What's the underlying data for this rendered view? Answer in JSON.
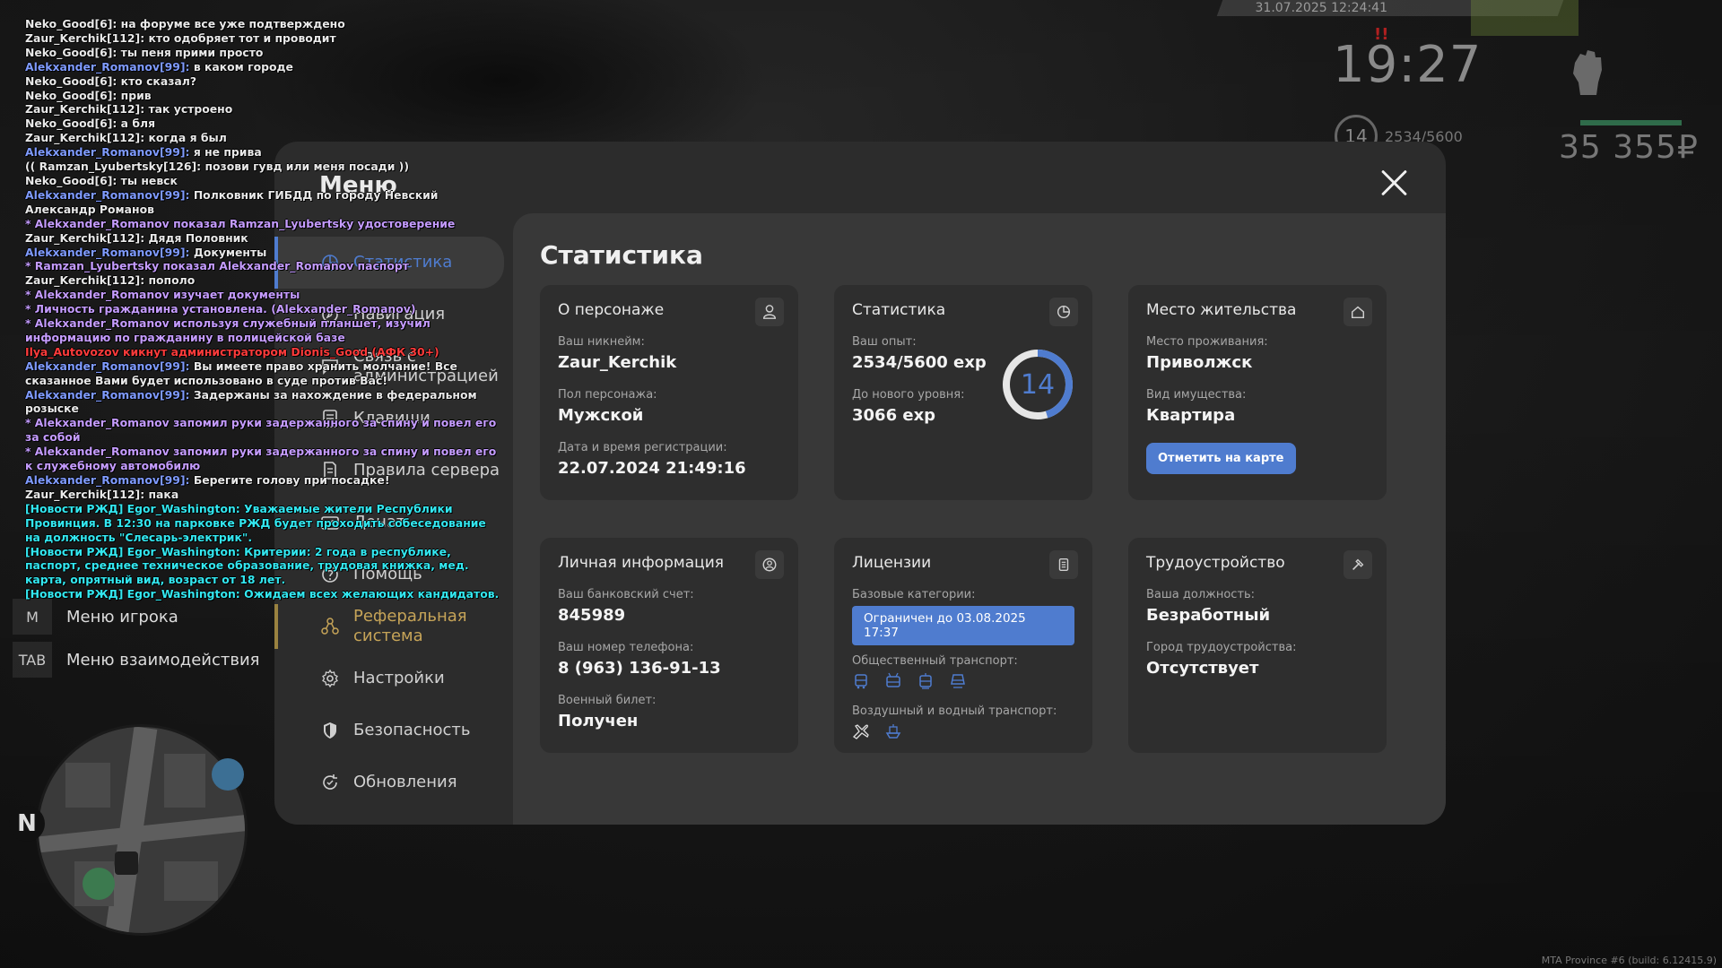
{
  "chat": [
    {
      "nick": "Neko_Good[6]:",
      "text": " на форуме все уже подтверждено",
      "nick_color": "white",
      "text_color": "white"
    },
    {
      "nick": "Zaur_Kerchik[112]:",
      "text": " кто одобряет тот и проводит",
      "nick_color": "white",
      "text_color": "white"
    },
    {
      "nick": "Neko_Good[6]:",
      "text": " ты пеня прими просто",
      "nick_color": "white",
      "text_color": "white"
    },
    {
      "nick": "Alekxander_Romanov[99]:",
      "text": " в каком городе",
      "nick_color": "blue",
      "text_color": "white"
    },
    {
      "nick": "Neko_Good[6]:",
      "text": " кто сказал?",
      "nick_color": "white",
      "text_color": "white"
    },
    {
      "nick": "Neko_Good[6]:",
      "text": " прив",
      "nick_color": "white",
      "text_color": "white"
    },
    {
      "nick": "Zaur_Kerchik[112]:",
      "text": " так устроено",
      "nick_color": "white",
      "text_color": "white"
    },
    {
      "nick": "Neko_Good[6]:",
      "text": " а бля",
      "nick_color": "white",
      "text_color": "white"
    },
    {
      "nick": "Zaur_Kerchik[112]:",
      "text": " когда я был",
      "nick_color": "white",
      "text_color": "white"
    },
    {
      "nick": "Alekxander_Romanov[99]:",
      "text": " я не прива",
      "nick_color": "blue",
      "text_color": "white"
    },
    {
      "nick": "((",
      "text": " Ramzan_Lyubertsky[126]: позови гувд или меня посади ))",
      "nick_color": "white",
      "text_color": "white"
    },
    {
      "nick": "Neko_Good[6]:",
      "text": " ты невск",
      "nick_color": "white",
      "text_color": "white"
    },
    {
      "nick": "Alekxander_Romanov[99]:",
      "text": " Полковник ГИБДД по городу Невский Александр Романов",
      "nick_color": "blue",
      "text_color": "white"
    },
    {
      "nick": "",
      "text": "* Alekxander_Romanov показал Ramzan_Lyubertsky удостоверение",
      "nick_color": "purple",
      "text_color": "purple"
    },
    {
      "nick": "Zaur_Kerchik[112]:",
      "text": " Дядя Половник",
      "nick_color": "white",
      "text_color": "white"
    },
    {
      "nick": "Alekxander_Romanov[99]:",
      "text": " Документы",
      "nick_color": "blue",
      "text_color": "white"
    },
    {
      "nick": "",
      "text": "* Ramzan_Lyubertsky показал Alekxander_Romanov паспорт",
      "nick_color": "purple",
      "text_color": "purple"
    },
    {
      "nick": "Zaur_Kerchik[112]:",
      "text": " пополо",
      "nick_color": "white",
      "text_color": "white"
    },
    {
      "nick": "",
      "text": "* Alekxander_Romanov изучает документы",
      "nick_color": "purple",
      "text_color": "purple"
    },
    {
      "nick": "",
      "text": "* Личность гражданина установлена. (Alekxander_Romanov)",
      "nick_color": "purple",
      "text_color": "purple"
    },
    {
      "nick": "",
      "text": "* Alekxander_Romanov используя служебный планшет, изучил информацию по гражданину в полицейской базе",
      "nick_color": "purple",
      "text_color": "purple"
    },
    {
      "nick": "",
      "text": "Ilya_Autovozov кикнут администратором Dionis_Good (АФК 30+)",
      "nick_color": "red",
      "text_color": "red"
    },
    {
      "nick": "Alekxander_Romanov[99]:",
      "text": " Вы имеете право хранить молчание! Все сказанное Вами будет использовано в суде против Вас!",
      "nick_color": "blue",
      "text_color": "white"
    },
    {
      "nick": "Alekxander_Romanov[99]:",
      "text": " Задержаны за нахождение в федеральном розыске",
      "nick_color": "blue",
      "text_color": "white"
    },
    {
      "nick": "",
      "text": "* Alekxander_Romanov запомил руки задержанного за спину и повел его за собой",
      "nick_color": "purple",
      "text_color": "purple"
    },
    {
      "nick": "",
      "text": "* Alekxander_Romanov запомил руки задержанного за спину и повел его к служебному автомобилю",
      "nick_color": "purple",
      "text_color": "purple"
    },
    {
      "nick": "Alekxander_Romanov[99]:",
      "text": " Берегите голову при посадке!",
      "nick_color": "blue",
      "text_color": "white"
    },
    {
      "nick": "Zaur_Kerchik[112]:",
      "text": " пака",
      "nick_color": "white",
      "text_color": "white"
    },
    {
      "nick": "",
      "text": "[Новости РЖД] Egor_Washington: Уважаемые жители Республики Провинция. В 12:30 на парковке РЖД будет проходить собеседование на должность \"Слесарь-электрик\".",
      "nick_color": "cyan",
      "text_color": "cyan"
    },
    {
      "nick": "",
      "text": "[Новости РЖД] Egor_Washington: Критерии: 2 года в республике, паспорт, среднее техническое образование, трудовая книжка, мед. карта, опрятный вид, возраст от 18 лет.",
      "nick_color": "cyan",
      "text_color": "cyan"
    },
    {
      "nick": "",
      "text": "[Новости РЖД] Egor_Washington: Ожидаем всех желающих кандидатов.",
      "nick_color": "cyan",
      "text_color": "cyan"
    }
  ],
  "hud": {
    "datetime": "31.07.2025 12:24:41",
    "clock": "19:27",
    "warning": "!!",
    "level": "14",
    "exp": "2534/5600",
    "money": "35 355₽",
    "health_fraction": 0.96
  },
  "quick_menu": [
    {
      "key": "M",
      "label": "Меню игрока"
    },
    {
      "key": "TAB",
      "label": "Меню взаимодействия"
    }
  ],
  "menu": {
    "title": "Меню",
    "nav": [
      {
        "label": "Статистика",
        "icon": "chart-pie-icon",
        "state": "active"
      },
      {
        "label": "Навигация",
        "icon": "compass-icon",
        "state": ""
      },
      {
        "label": "Связь с администрацией",
        "icon": "chat-icon",
        "state": ""
      },
      {
        "label": "Клавиши",
        "icon": "keyboard-icon",
        "state": ""
      },
      {
        "label": "Правила сервера",
        "icon": "document-icon",
        "state": ""
      },
      {
        "label": "Донат",
        "icon": "wallet-icon",
        "state": ""
      },
      {
        "label": "Помощь",
        "icon": "help-icon",
        "state": ""
      },
      {
        "label": "Реферальная система",
        "icon": "referral-icon",
        "state": "gold"
      },
      {
        "label": "Настройки",
        "icon": "gear-icon",
        "state": ""
      },
      {
        "label": "Безопасность",
        "icon": "shield-icon",
        "state": ""
      },
      {
        "label": "Обновления",
        "icon": "refresh-icon",
        "state": ""
      }
    ],
    "section_title": "Статистика",
    "character": {
      "title": "О персонаже",
      "icon": "user-icon",
      "nickname_label": "Ваш никнейм:",
      "nickname": "Zaur_Kerchik",
      "gender_label": "Пол персонажа:",
      "gender": "Мужской",
      "reg_label": "Дата и время регистрации:",
      "reg_date": "22.07.2024 21:49:16"
    },
    "stats": {
      "title": "Статистика",
      "icon": "chart-pie-icon",
      "exp_label": "Ваш опыт:",
      "exp": "2534/5600 exp",
      "next_label": "До нового уровня:",
      "next": "3066 exp",
      "level": "14",
      "level_progress": 0.4525,
      "accent": "#4f7ccf"
    },
    "residence": {
      "title": "Место жительства",
      "icon": "home-icon",
      "place_label": "Место проживания:",
      "place": "Приволжск",
      "property_label": "Вид имущества:",
      "property": "Квартира",
      "map_button": "Отметить на карте"
    },
    "personal": {
      "title": "Личная информация",
      "icon": "id-icon",
      "bank_label": "Ваш банковский счет:",
      "bank": "845989",
      "phone_label": "Ваш номер телефона:",
      "phone": "8 (963) 136-91-13",
      "military_label": "Военный билет:",
      "military": "Получен"
    },
    "licenses": {
      "title": "Лицензии",
      "icon": "license-icon",
      "base_label": "Базовые категории:",
      "base_badge": "Ограничен до 03.08.2025 17:37",
      "public_label": "Общественный транспорт:",
      "public_icons": [
        "bus-icon",
        "trolleybus-icon",
        "tram-icon",
        "train-icon"
      ],
      "air_label": "Воздушный и водный транспорт:",
      "air_icons": [
        "plane-icon",
        "boat-icon"
      ]
    },
    "employment": {
      "title": "Трудоустройство",
      "icon": "hammer-icon",
      "position_label": "Ваша должность:",
      "position": "Безработный",
      "city_label": "Город трудоустройства:",
      "city": "Отсутствует"
    }
  },
  "watermark": "MTA Province #6 (build: 6.12415.9)"
}
